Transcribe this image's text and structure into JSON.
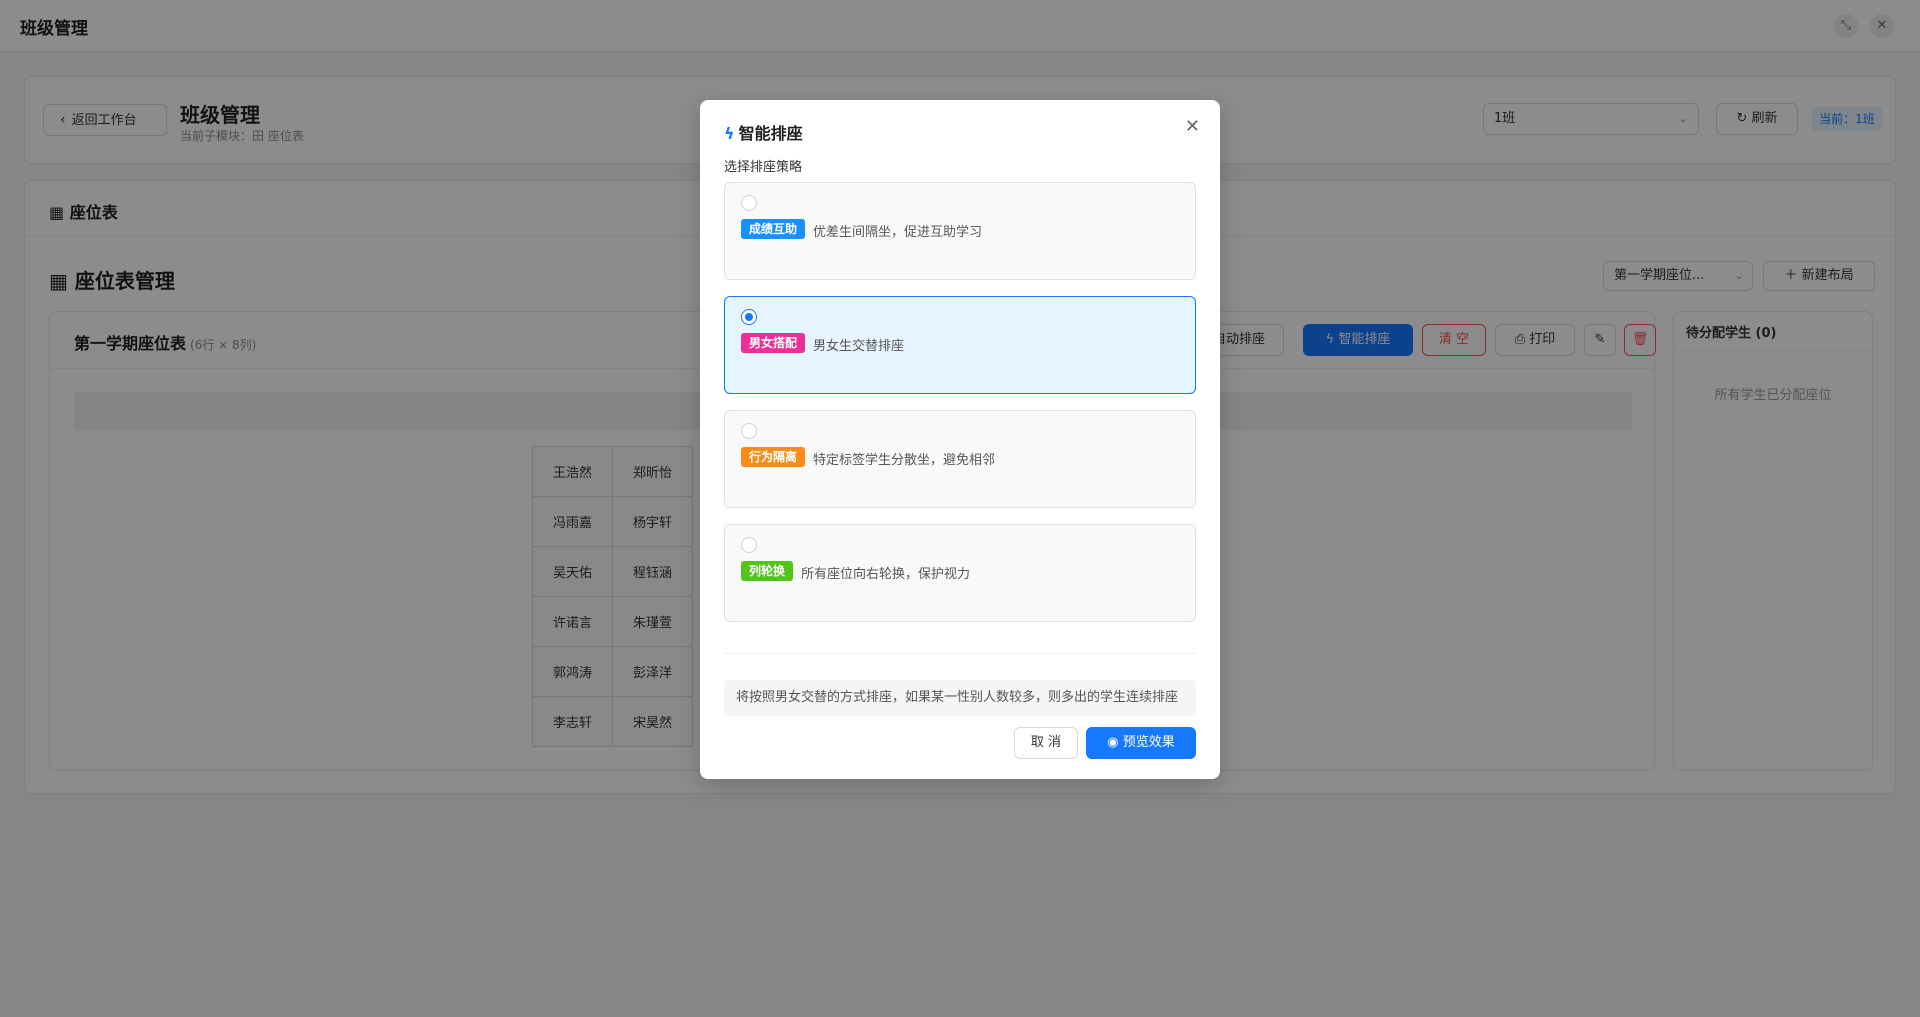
{
  "app": {
    "title": "班级管理"
  },
  "header": {
    "back_label": "返回工作台",
    "title": "班级管理",
    "submodule": "当前子模块：田 座位表",
    "class_select": "1班",
    "refresh_label": "刷新",
    "current_label": "当前：1班"
  },
  "section": {
    "label": "座位表",
    "mgmt_title": "座位表管理",
    "layout_select": "第一学期座位...",
    "new_layout_label": "新建布局"
  },
  "seat_panel": {
    "title": "第一学期座位表",
    "dimensions": "(6行 × 8列)",
    "auto_label": "自动排座",
    "smart_label": "智能排座",
    "clear_label": "清 空",
    "print_label": "打印",
    "grid": [
      [
        "王浩然",
        "郑昕怡"
      ],
      [
        "冯雨嘉",
        "杨宇轩"
      ],
      [
        "吴天佑",
        "程钰涵"
      ],
      [
        "许诺言",
        "朱瑾萱"
      ],
      [
        "郭鸿涛",
        "彭泽洋"
      ],
      [
        "李志轩",
        "宋昊然"
      ]
    ]
  },
  "pending": {
    "title": "待分配学生 (0)",
    "empty": "所有学生已分配座位"
  },
  "modal": {
    "title": "智能排座",
    "subtitle": "选择排座策略",
    "options": [
      {
        "tag": "成绩互助",
        "tag_color": "#1890ff",
        "desc": "优差生间隔坐，促进互助学习",
        "selected": false
      },
      {
        "tag": "男女搭配",
        "tag_color": "#eb2f96",
        "desc": "男女生交替排座",
        "selected": true
      },
      {
        "tag": "行为隔离",
        "tag_color": "#fa8c16",
        "desc": "特定标签学生分散坐，避免相邻",
        "selected": false
      },
      {
        "tag": "列轮换",
        "tag_color": "#52c41a",
        "desc": "所有座位向右轮换，保护视力",
        "selected": false
      }
    ],
    "hint": "将按照男女交替的方式排座，如果某一性别人数较多，则多出的学生连续排座",
    "cancel_label": "取 消",
    "preview_label": "预览效果"
  },
  "colors": {
    "primary": "#1677ff",
    "danger": "#ff4d4f"
  },
  "icons": [
    "bolt-icon",
    "close-icon",
    "refresh-icon",
    "plus-icon",
    "print-icon",
    "edit-icon",
    "delete-icon",
    "eye-icon",
    "grid-icon",
    "chevron-left-icon",
    "chevron-down-icon"
  ]
}
